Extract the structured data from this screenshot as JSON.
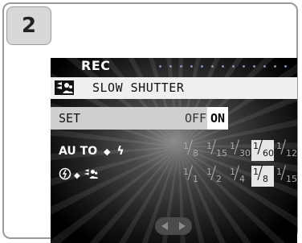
{
  "step_number": "2",
  "screen": {
    "title": "REC",
    "menu_item": {
      "label": "SLOW SHUTTER",
      "icon": "slow-shutter-person-icon"
    },
    "set_row": {
      "label": "SET",
      "options": [
        "OFF",
        "ON"
      ],
      "selected": "ON"
    },
    "auto_row": {
      "label": "AU TO",
      "bullet": "◆",
      "flash_icon": "ϟ",
      "fractions": [
        {
          "num": "1",
          "den": "8"
        },
        {
          "num": "1",
          "den": "15"
        },
        {
          "num": "1",
          "den": "30"
        },
        {
          "num": "1",
          "den": "60",
          "selected": true
        },
        {
          "num": "1",
          "den": "125"
        }
      ]
    },
    "flash_off_row": {
      "bullet": "◆",
      "fractions": [
        {
          "num": "1",
          "den": "1"
        },
        {
          "num": "1",
          "den": "2"
        },
        {
          "num": "1",
          "den": "4"
        },
        {
          "num": "1",
          "den": "8",
          "selected": true
        },
        {
          "num": "1",
          "den": "15"
        }
      ]
    }
  }
}
